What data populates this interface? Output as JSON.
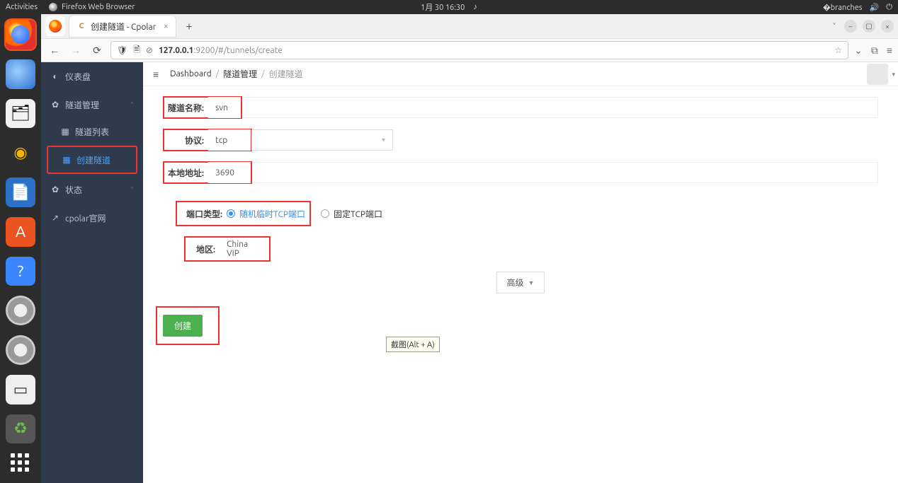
{
  "gnome": {
    "activities": "Activities",
    "app_label": "Firefox Web Browser",
    "clock": "1月 30  16:30"
  },
  "browser": {
    "tab_title": "创建隧道 - Cpolar",
    "url_host": "127.0.0.1",
    "url_path": ":9200/#/tunnels/create"
  },
  "sidebar": {
    "dashboard": "仪表盘",
    "tunnel_mgmt": "隧道管理",
    "tunnel_list": "隧道列表",
    "create_tunnel": "创建隧道",
    "status": "状态",
    "cpolar_site": "cpolar官网"
  },
  "breadcrumb": {
    "dashboard": "Dashboard",
    "tunnel_mgmt": "隧道管理",
    "create_tunnel": "创建隧道"
  },
  "form": {
    "name_label": "隧道名称:",
    "name_value": "svn",
    "proto_label": "协议:",
    "proto_value": "tcp",
    "addr_label": "本地地址:",
    "addr_value": "3690",
    "port_type_label": "端口类型:",
    "port_random": "随机临时TCP端口",
    "port_fixed": "固定TCP端口",
    "region_label": "地区:",
    "region_value": "China VIP",
    "advanced": "高级",
    "create": "创建"
  },
  "tooltip": "截图(Alt + A)"
}
